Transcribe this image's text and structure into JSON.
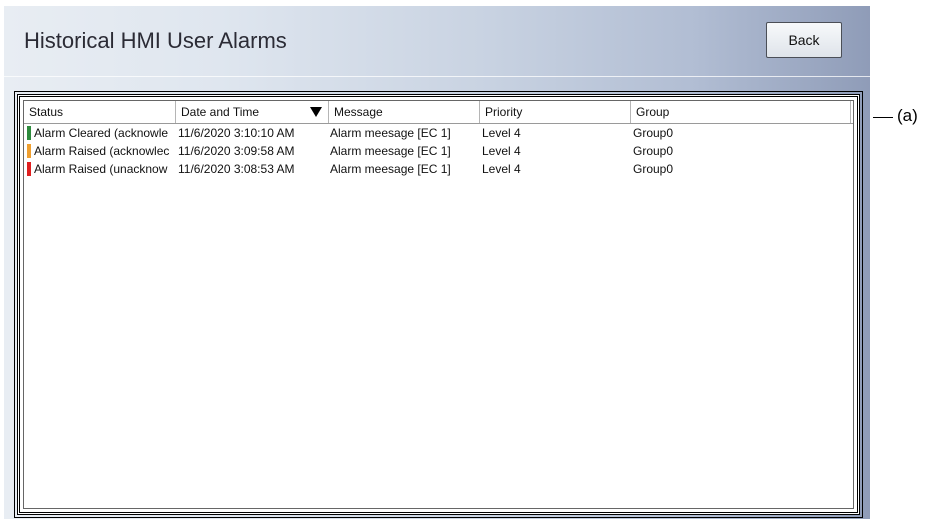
{
  "window": {
    "title": "Historical HMI User Alarms"
  },
  "toolbar": {
    "back_label": "Back"
  },
  "table": {
    "columns": [
      "Status",
      "Date and Time",
      "Message",
      "Priority",
      "Group"
    ],
    "sorted_column": "Date and Time",
    "sort_direction": "descending",
    "rows": [
      {
        "status": "Alarm Cleared (acknowle",
        "status_color": "#2e8b3d",
        "datetime": "11/6/2020 3:10:10 AM",
        "message": "Alarm meesage [EC 1]",
        "priority": "Level 4",
        "group": "Group0"
      },
      {
        "status": "Alarm Raised (acknowlec",
        "status_color": "#f0a030",
        "datetime": "11/6/2020 3:09:58 AM",
        "message": "Alarm meesage [EC 1]",
        "priority": "Level 4",
        "group": "Group0"
      },
      {
        "status": "Alarm Raised (unacknow",
        "status_color": "#e02020",
        "datetime": "11/6/2020 3:08:53 AM",
        "message": "Alarm meesage [EC 1]",
        "priority": "Level 4",
        "group": "Group0"
      }
    ]
  },
  "annotation": {
    "label": "(a)"
  }
}
